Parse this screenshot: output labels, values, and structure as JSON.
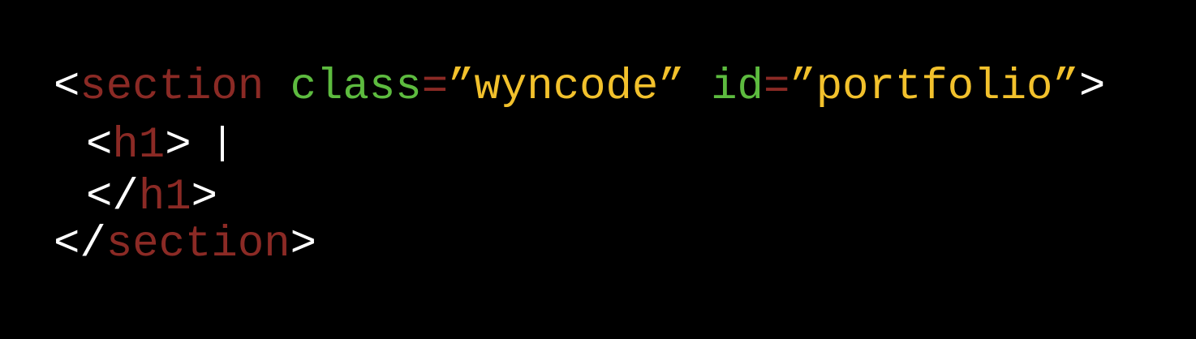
{
  "colors": {
    "background": "#000000",
    "punctuation": "#ffffff",
    "tag": "#8b2a25",
    "attribute": "#5dbb3f",
    "string": "#f2c12c",
    "cursor": "#ffffff"
  },
  "code": {
    "line1": {
      "open_bracket": "<",
      "tag": "section",
      "space1": " ",
      "attr1": "class",
      "eq1": "=",
      "val1": "”wyncode”",
      "space2": " ",
      "attr2": "id",
      "eq2": "=",
      "val2": "”portfolio”",
      "close_bracket": ">"
    },
    "line2": {
      "open_bracket": "<",
      "tag": "h1",
      "close_bracket": ">",
      "space": " "
    },
    "line3": {
      "open_bracket": "</",
      "tag": "h1",
      "close_bracket": ">"
    },
    "line4": {
      "open_bracket": "</",
      "tag": "section",
      "close_bracket": ">"
    }
  }
}
